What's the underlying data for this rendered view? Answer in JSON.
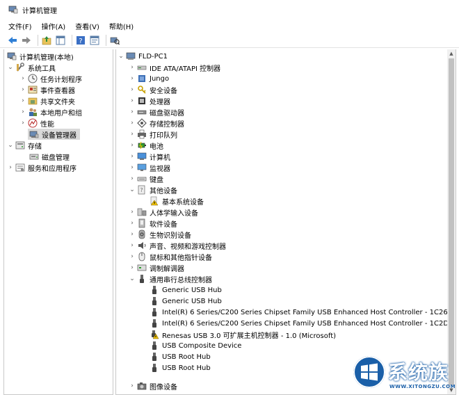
{
  "window": {
    "title": "计算机管理"
  },
  "menu": [
    "文件(F)",
    "操作(A)",
    "查看(V)",
    "帮助(H)"
  ],
  "left_tree": [
    {
      "label": "计算机管理(本地)",
      "arrow": "",
      "icon": "computer-management-icon"
    },
    {
      "label": "系统工具",
      "arrow": "v",
      "icon": "tools-icon"
    },
    {
      "label": "任务计划程序",
      "arrow": ">",
      "icon": "clock-icon"
    },
    {
      "label": "事件查看器",
      "arrow": ">",
      "icon": "event-viewer-icon"
    },
    {
      "label": "共享文件夹",
      "arrow": ">",
      "icon": "shared-folder-icon"
    },
    {
      "label": "本地用户和组",
      "arrow": ">",
      "icon": "users-icon"
    },
    {
      "label": "性能",
      "arrow": ">",
      "icon": "performance-icon"
    },
    {
      "label": "设备管理器",
      "arrow": "",
      "icon": "device-manager-icon",
      "selected": true
    },
    {
      "label": "存储",
      "arrow": "v",
      "icon": "storage-icon"
    },
    {
      "label": "磁盘管理",
      "arrow": "",
      "icon": "disk-management-icon"
    },
    {
      "label": "服务和应用程序",
      "arrow": ">",
      "icon": "services-icon"
    }
  ],
  "device_tree": {
    "root": "FLD-PC1",
    "items": [
      {
        "label": "IDE ATA/ATAPI 控制器",
        "arrow": ">",
        "icon": "ide-controller-icon"
      },
      {
        "label": "Jungo",
        "arrow": ">",
        "icon": "jungo-icon"
      },
      {
        "label": "安全设备",
        "arrow": ">",
        "icon": "security-device-icon"
      },
      {
        "label": "处理器",
        "arrow": ">",
        "icon": "processor-icon"
      },
      {
        "label": "磁盘驱动器",
        "arrow": ">",
        "icon": "disk-drive-icon"
      },
      {
        "label": "存储控制器",
        "arrow": ">",
        "icon": "storage-controller-icon"
      },
      {
        "label": "打印队列",
        "arrow": ">",
        "icon": "printer-icon"
      },
      {
        "label": "电池",
        "arrow": ">",
        "icon": "battery-icon"
      },
      {
        "label": "计算机",
        "arrow": ">",
        "icon": "computer-icon"
      },
      {
        "label": "监视器",
        "arrow": ">",
        "icon": "monitor-icon"
      },
      {
        "label": "键盘",
        "arrow": ">",
        "icon": "keyboard-icon"
      },
      {
        "label": "其他设备",
        "arrow": "v",
        "icon": "other-devices-icon"
      },
      {
        "label": "基本系统设备",
        "arrow": "",
        "icon": "warning-device-icon"
      },
      {
        "label": "人体学输入设备",
        "arrow": ">",
        "icon": "hid-icon"
      },
      {
        "label": "软件设备",
        "arrow": ">",
        "icon": "software-device-icon"
      },
      {
        "label": "生物识别设备",
        "arrow": ">",
        "icon": "biometric-icon"
      },
      {
        "label": "声音、视频和游戏控制器",
        "arrow": ">",
        "icon": "sound-icon"
      },
      {
        "label": "鼠标和其他指针设备",
        "arrow": ">",
        "icon": "mouse-icon"
      },
      {
        "label": "调制解调器",
        "arrow": ">",
        "icon": "modem-icon"
      },
      {
        "label": "通用串行总线控制器",
        "arrow": "v",
        "icon": "usb-icon"
      },
      {
        "label": "Generic USB Hub",
        "arrow": "",
        "icon": "usb-device-icon"
      },
      {
        "label": "Generic USB Hub",
        "arrow": "",
        "icon": "usb-device-icon"
      },
      {
        "label": "Intel(R) 6 Series/C200 Series Chipset Family USB Enhanced Host Controller - 1C26",
        "arrow": "",
        "icon": "usb-device-icon"
      },
      {
        "label": "Intel(R) 6 Series/C200 Series Chipset Family USB Enhanced Host Controller - 1C2D",
        "arrow": "",
        "icon": "usb-device-icon"
      },
      {
        "label": "Renesas USB 3.0 可扩展主机控制器 - 1.0 (Microsoft)",
        "arrow": "",
        "icon": "usb-warning-icon"
      },
      {
        "label": "USB Composite Device",
        "arrow": "",
        "icon": "usb-device-icon"
      },
      {
        "label": "USB Root Hub",
        "arrow": "",
        "icon": "usb-device-icon"
      },
      {
        "label": "USB Root Hub",
        "arrow": "",
        "icon": "usb-device-icon"
      },
      {
        "label": "图像设备",
        "arrow": ">",
        "icon": "imaging-device-icon"
      }
    ]
  },
  "watermark": {
    "text": "系统族",
    "url": "WWW.XITONGZU.COM"
  }
}
